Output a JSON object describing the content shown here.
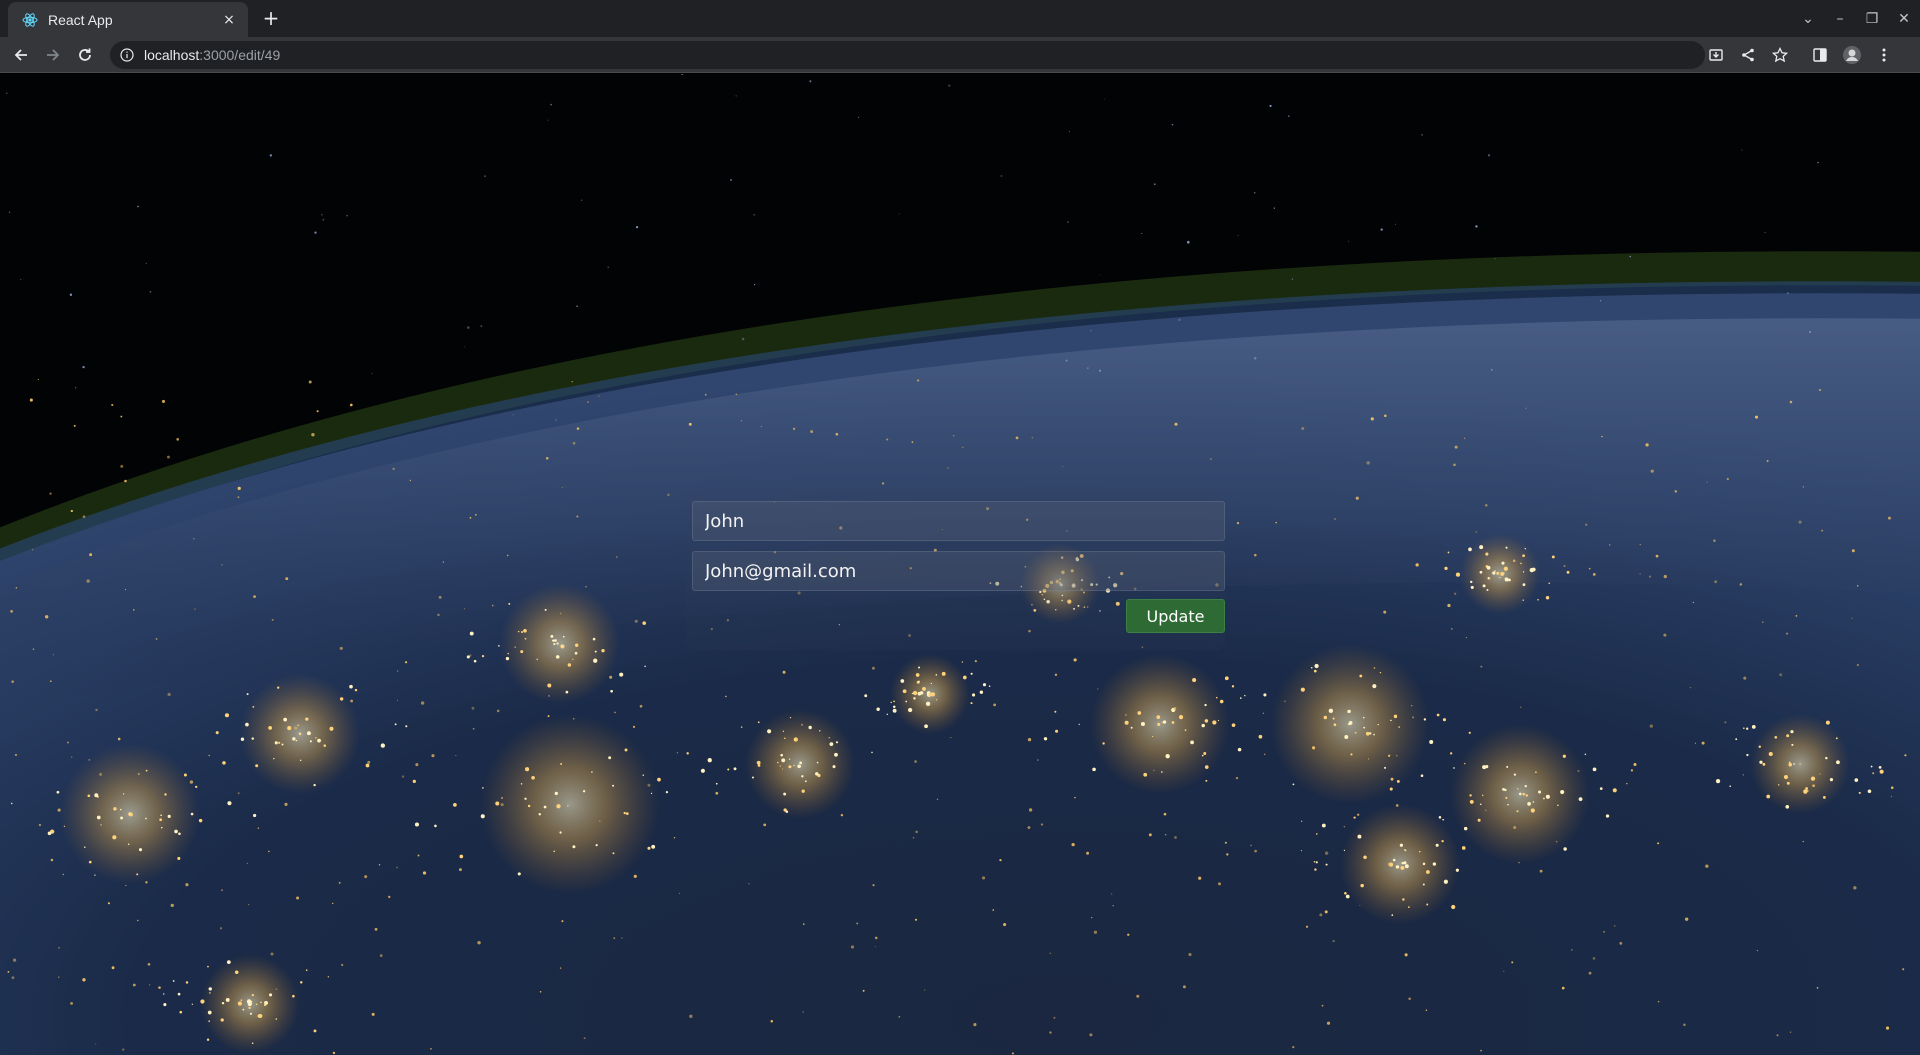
{
  "browser": {
    "tab_title": "React App",
    "tab_close": "×",
    "new_tab": "+",
    "url_host": "localhost",
    "url_path": ":3000/edit/49",
    "window_controls": [
      "⌄",
      "–",
      "❐",
      "✕"
    ]
  },
  "form": {
    "name_value": "John",
    "email_value": "John@gmail.com",
    "update_label": "Update",
    "button_color": "#2e6b34"
  },
  "background": {
    "description_icon": "earth-at-night-image"
  }
}
